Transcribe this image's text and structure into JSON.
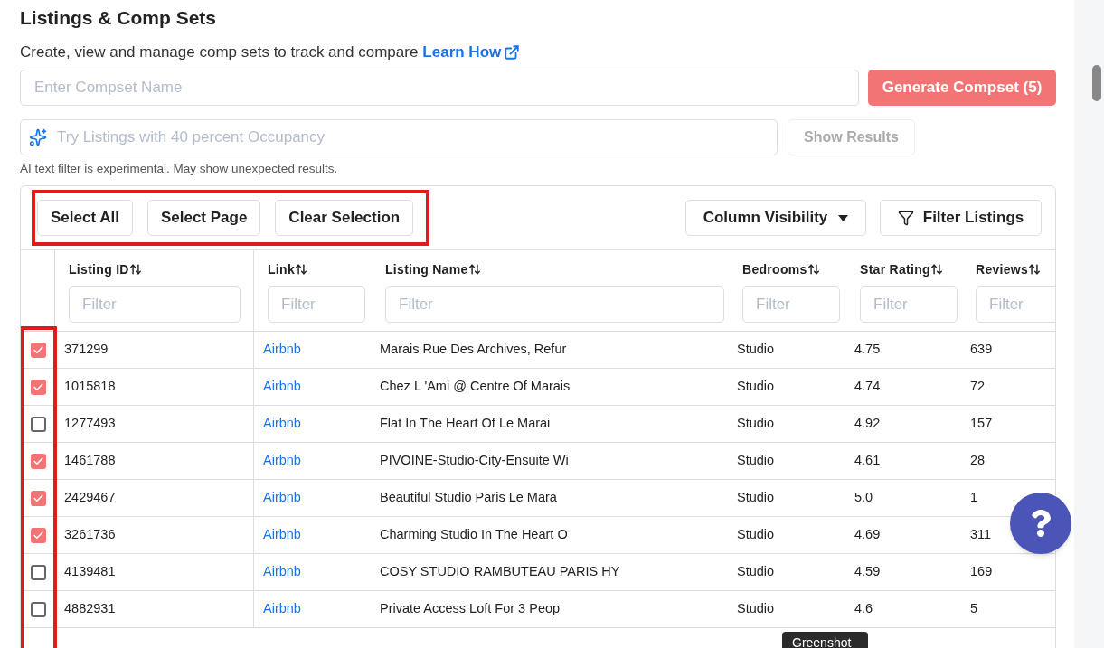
{
  "title": "Listings & Comp Sets",
  "subtitle": {
    "text": "Create, view and manage comp sets to track and compare",
    "link": "Learn How"
  },
  "compset_input": {
    "placeholder": "Enter Compset Name"
  },
  "generate_button": {
    "label": "Generate Compset (5)"
  },
  "ai_filter": {
    "placeholder": "Try Listings with 40 percent Occupancy"
  },
  "show_results_button": {
    "label": "Show Results",
    "disabled": true
  },
  "ai_note": "AI text filter is experimental. May show unexpected results.",
  "toolbar": {
    "selection_buttons": [
      "Select All",
      "Select Page",
      "Clear Selection"
    ],
    "column_visibility": "Column Visibility",
    "filter_listings": "Filter Listings"
  },
  "table": {
    "columns": [
      {
        "label": "Listing ID",
        "filter_placeholder": "Filter"
      },
      {
        "label": "Link",
        "filter_placeholder": "Filter"
      },
      {
        "label": "Listing Name",
        "filter_placeholder": "Filter"
      },
      {
        "label": "Bedrooms",
        "filter_placeholder": "Filter"
      },
      {
        "label": "Star Rating",
        "filter_placeholder": "Filter"
      },
      {
        "label": "Reviews",
        "filter_placeholder": "Filter"
      }
    ],
    "rows": [
      {
        "selected": true,
        "cells": [
          "371299",
          "Airbnb",
          "Marais Rue Des Archives, Refur",
          "Studio",
          "4.75",
          "639"
        ]
      },
      {
        "selected": true,
        "cells": [
          "1015818",
          "Airbnb",
          "Chez L 'Ami @ Centre Of Marais",
          "Studio",
          "4.74",
          "72"
        ]
      },
      {
        "selected": false,
        "cells": [
          "1277493",
          "Airbnb",
          "Flat In The Heart Of Le Marai",
          "Studio",
          "4.92",
          "157"
        ]
      },
      {
        "selected": true,
        "cells": [
          "1461788",
          "Airbnb",
          "PIVOINE-Studio-City-Ensuite Wi",
          "Studio",
          "4.61",
          "28"
        ]
      },
      {
        "selected": true,
        "cells": [
          "2429467",
          "Airbnb",
          "Beautiful Studio Paris Le Mara",
          "Studio",
          "5.0",
          "1"
        ]
      },
      {
        "selected": true,
        "cells": [
          "3261736",
          "Airbnb",
          "Charming Studio In The Heart O",
          "Studio",
          "4.69",
          "311"
        ]
      },
      {
        "selected": false,
        "cells": [
          "4139481",
          "Airbnb",
          "COSY STUDIO RAMBUTEAU PARIS HY",
          "Studio",
          "4.59",
          "169"
        ]
      },
      {
        "selected": false,
        "cells": [
          "4882931",
          "Airbnb",
          "Private Access Loft For 3 Peop",
          "Studio",
          "4.6",
          "5"
        ]
      }
    ]
  },
  "tooltip": "Greenshot"
}
